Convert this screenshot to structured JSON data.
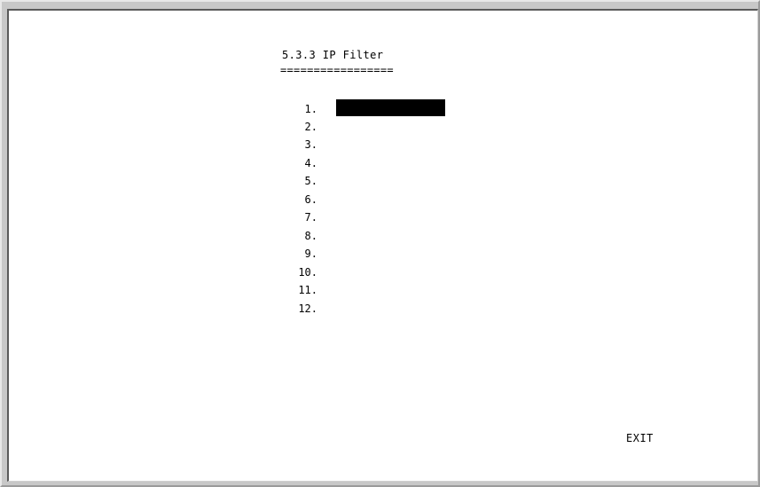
{
  "screen": {
    "title": "5.3.3 IP Filter",
    "title_underline": "================="
  },
  "entries": [
    {
      "number": "1.",
      "value": "",
      "selected": true
    },
    {
      "number": "2.",
      "value": ""
    },
    {
      "number": "3.",
      "value": ""
    },
    {
      "number": "4.",
      "value": ""
    },
    {
      "number": "5.",
      "value": ""
    },
    {
      "number": "6.",
      "value": ""
    },
    {
      "number": "7.",
      "value": ""
    },
    {
      "number": "8.",
      "value": ""
    },
    {
      "number": "9.",
      "value": ""
    },
    {
      "number": "10.",
      "value": ""
    },
    {
      "number": "11.",
      "value": ""
    },
    {
      "number": "12.",
      "value": ""
    }
  ],
  "actions": {
    "exit_label": "EXIT"
  },
  "colors": {
    "background": "#ffffff",
    "text": "#000000",
    "highlight": "#000000"
  }
}
